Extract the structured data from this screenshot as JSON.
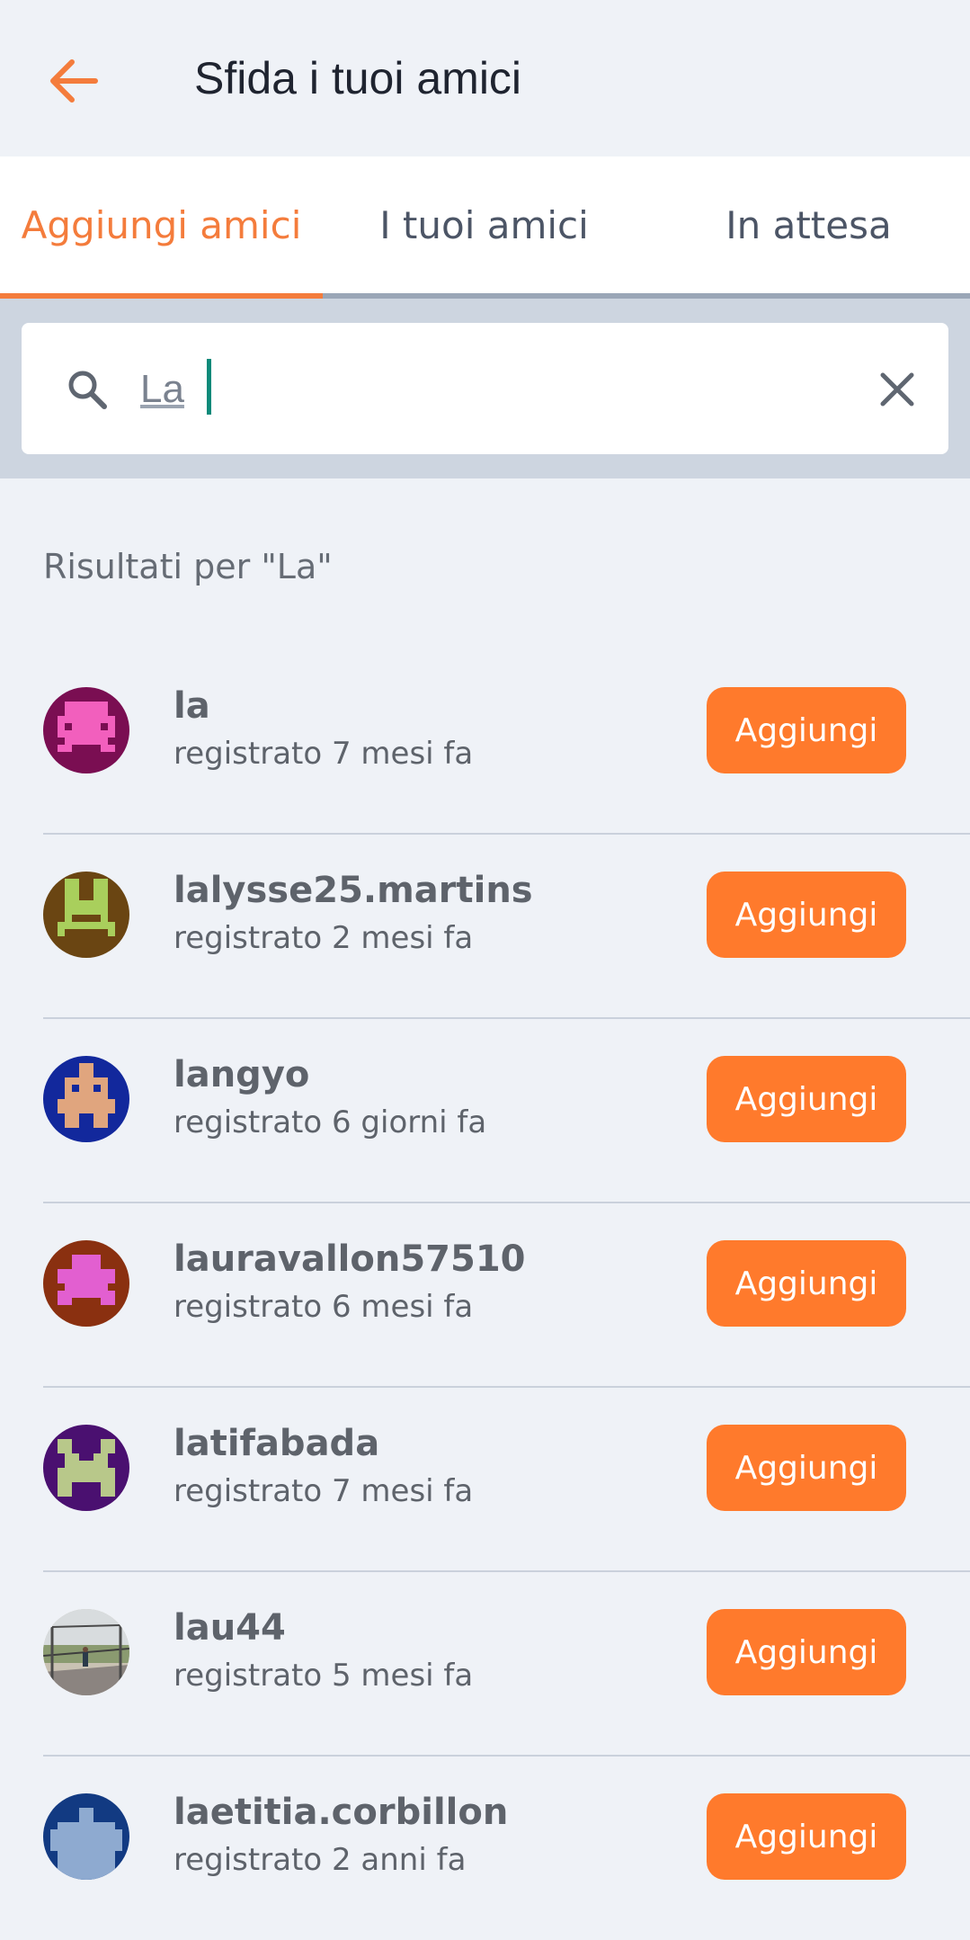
{
  "header": {
    "title": "Sfida i tuoi amici"
  },
  "tabs": [
    {
      "label": "Aggiungi amici",
      "active": true
    },
    {
      "label": "I tuoi amici",
      "active": false
    },
    {
      "label": "In attesa",
      "active": false
    }
  ],
  "search": {
    "value": "La"
  },
  "results": {
    "heading": "Risultati per \"La\"",
    "items": [
      {
        "name": "la",
        "registered": "registrato 7 mesi fa",
        "button": "Aggiungi"
      },
      {
        "name": "lalysse25.martins",
        "registered": "registrato 2 mesi fa",
        "button": "Aggiungi"
      },
      {
        "name": "langyo",
        "registered": "registrato 6 giorni fa",
        "button": "Aggiungi"
      },
      {
        "name": "lauravallon57510",
        "registered": "registrato 6 mesi fa",
        "button": "Aggiungi"
      },
      {
        "name": "latifabada",
        "registered": "registrato 7 mesi fa",
        "button": "Aggiungi"
      },
      {
        "name": "lau44",
        "registered": "registrato 5 mesi fa",
        "button": "Aggiungi"
      },
      {
        "name": "laetitia.corbillon",
        "registered": "registrato 2 anni fa",
        "button": "Aggiungi"
      }
    ]
  },
  "colors": {
    "accent": "#ff7a2c",
    "tab_active": "#f47c3c",
    "background": "#eff2f7"
  }
}
